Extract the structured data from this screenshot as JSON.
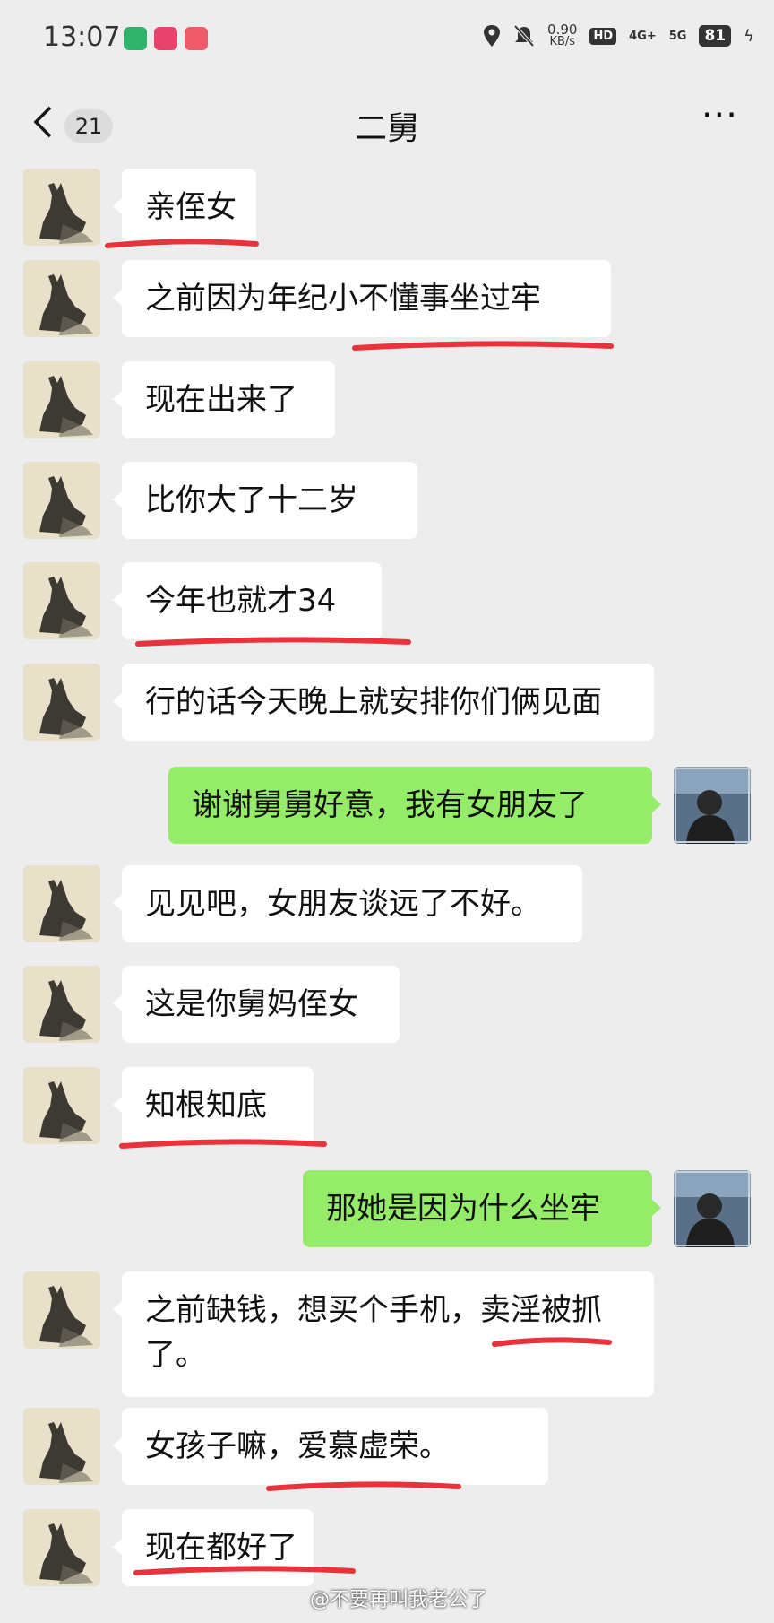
{
  "status_bar": {
    "time": "13:07",
    "net_speed": "0.90",
    "net_unit": "KB/s",
    "hd": "HD",
    "signal_4g": "4G+",
    "signal_5g": "5G",
    "battery": "81"
  },
  "nav": {
    "back_icon": "chevron-left-icon",
    "unread_count": "21",
    "title": "二舅",
    "more_label": "···"
  },
  "messages": [
    {
      "from": "contact",
      "text": "亲侄女"
    },
    {
      "from": "contact",
      "text": "之前因为年纪小不懂事坐过牢"
    },
    {
      "from": "contact",
      "text": "现在出来了"
    },
    {
      "from": "contact",
      "text": "比你大了十二岁"
    },
    {
      "from": "contact",
      "text": "今年也就才34"
    },
    {
      "from": "contact",
      "text": "行的话今天晚上就安排你们俩见面"
    },
    {
      "from": "me",
      "text": "谢谢舅舅好意，我有女朋友了"
    },
    {
      "from": "contact",
      "text": "见见吧，女朋友谈远了不好。"
    },
    {
      "from": "contact",
      "text": "这是你舅妈侄女"
    },
    {
      "from": "contact",
      "text": "知根知底"
    },
    {
      "from": "me",
      "text": "那她是因为什么坐牢"
    },
    {
      "from": "contact",
      "text": "之前缺钱，想买个手机，卖淫被抓了。"
    },
    {
      "from": "contact",
      "text": "女孩子嘛，爱慕虚荣。"
    },
    {
      "from": "contact",
      "text": "现在都好了"
    }
  ],
  "watermark": "@不要再叫我老公了",
  "colors": {
    "background": "#ededed",
    "contact_bubble": "#ffffff",
    "my_bubble": "#95ec69",
    "annotation_red": "#e8323c"
  }
}
